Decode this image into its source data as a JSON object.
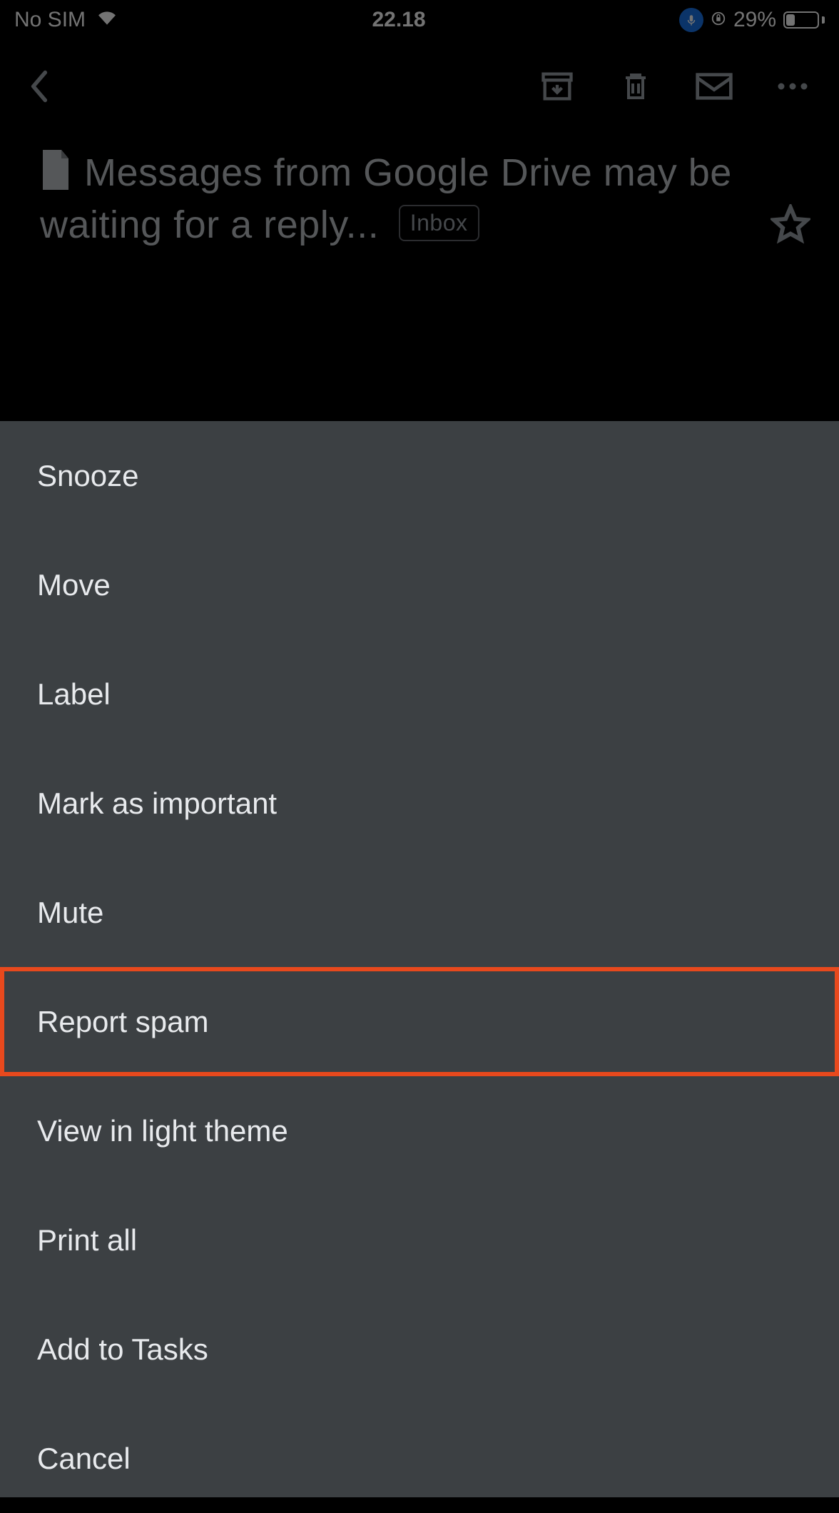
{
  "status": {
    "carrier": "No SIM",
    "time": "22.18",
    "battery_pct": "29%",
    "battery_fill_pct": 29
  },
  "toolbar": {
    "back": "Back",
    "archive": "Archive",
    "delete": "Delete",
    "mark_unread": "Mark unread",
    "more": "More"
  },
  "message": {
    "subject": "Messages from Google Drive may be waiting for a reply...",
    "folder": "Inbox"
  },
  "sheet": {
    "items": [
      {
        "label": "Snooze",
        "highlighted": false
      },
      {
        "label": "Move",
        "highlighted": false
      },
      {
        "label": "Label",
        "highlighted": false
      },
      {
        "label": "Mark as important",
        "highlighted": false
      },
      {
        "label": "Mute",
        "highlighted": false
      },
      {
        "label": "Report spam",
        "highlighted": true
      },
      {
        "label": "View in light theme",
        "highlighted": false
      },
      {
        "label": "Print all",
        "highlighted": false
      },
      {
        "label": "Add to Tasks",
        "highlighted": false
      },
      {
        "label": "Cancel",
        "highlighted": false
      }
    ]
  }
}
